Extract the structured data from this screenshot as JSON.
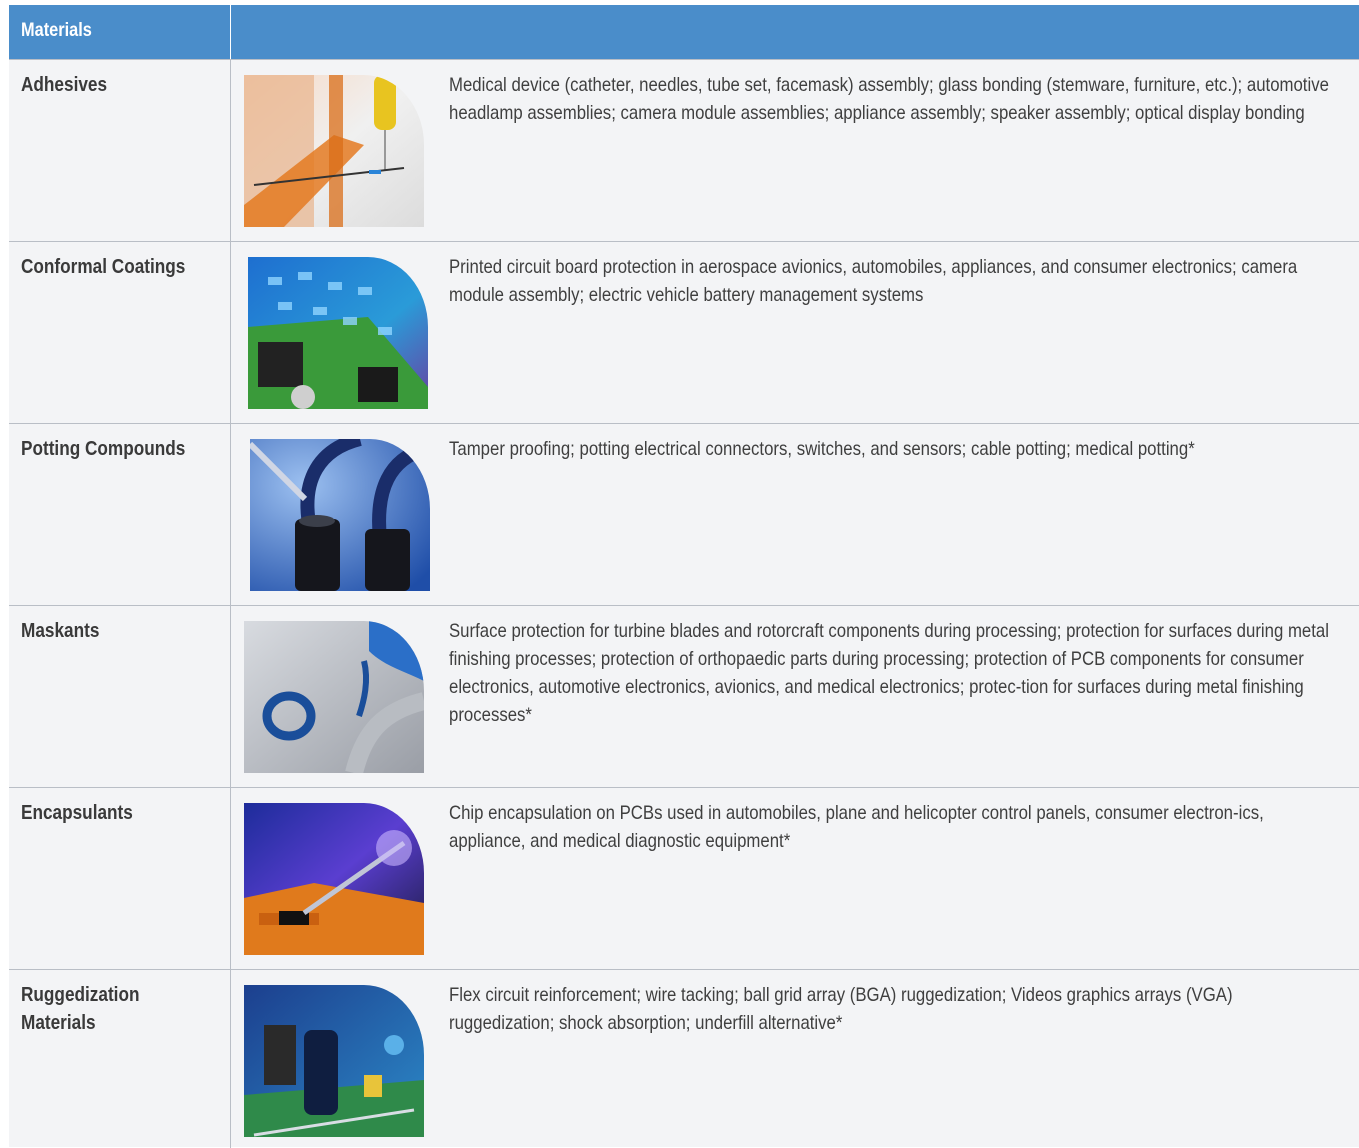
{
  "header": {
    "materials_label": "Materials"
  },
  "rows": [
    {
      "name": "Adhesives",
      "description": "Medical device (catheter, needles, tube set, facemask) assembly; glass bonding (stemware, furniture, etc.); automotive headlamp assemblies; camera module assemblies; appliance assembly; speaker assembly; optical display bonding"
    },
    {
      "name": "Conformal Coatings",
      "description": "Printed circuit board protection in aerospace avionics, automobiles, appliances, and consumer electronics; camera module assembly; electric vehicle battery management systems"
    },
    {
      "name": "Potting Compounds",
      "description": "Tamper proofing; potting electrical connectors, switches, and sensors; cable potting; medical potting*"
    },
    {
      "name": "Maskants",
      "description": "Surface protection for turbine blades and rotorcraft components during processing; protection for surfaces during metal finishing processes; protection of orthopaedic parts during processing; protection of PCB components for consumer electronics, automotive electronics, avionics, and medical electronics; protec-tion for surfaces during metal finishing processes*"
    },
    {
      "name": "Encapsulants",
      "description": "Chip encapsulation on PCBs used in automobiles, plane and helicopter control panels, consumer electron-ics, appliance, and medical diagnostic equipment*"
    },
    {
      "name": "Ruggedization Materials",
      "description": "Flex circuit reinforcement; wire tacking; ball grid array (BGA) ruggedization; Videos graphics arrays (VGA) ruggedization; shock absorption; underfill alternative*"
    }
  ]
}
